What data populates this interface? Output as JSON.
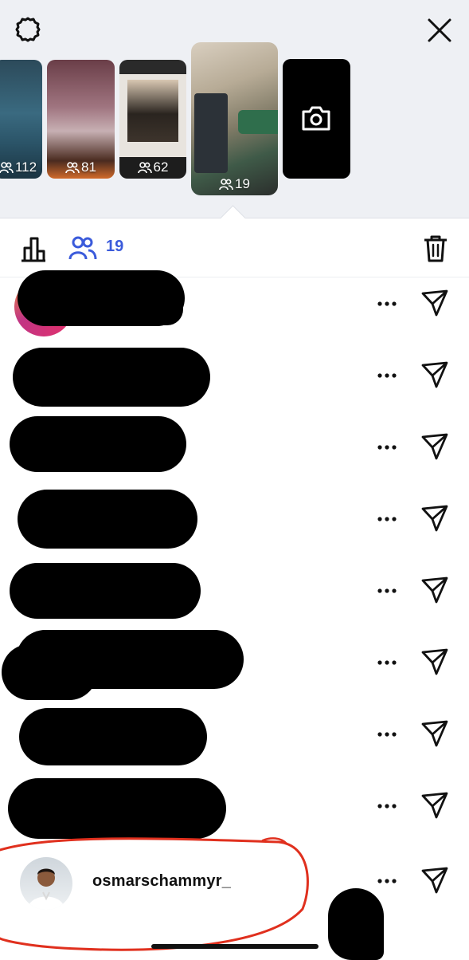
{
  "header": {
    "settings_icon": "settings-gear-icon",
    "close_icon": "close-icon"
  },
  "stories": [
    {
      "label": "112",
      "icon": "viewers-icon"
    },
    {
      "label": "81",
      "icon": "viewers-icon"
    },
    {
      "label": "62",
      "icon": "viewers-icon"
    },
    {
      "label": "19",
      "icon": "viewers-icon",
      "selected": true
    },
    {
      "label": "",
      "icon": "camera-icon"
    }
  ],
  "tabs": {
    "insights_icon": "bar-chart-icon",
    "viewers_icon": "viewers-icon",
    "viewers_count": "19",
    "delete_icon": "trash-icon",
    "accent": "#3b5bdb"
  },
  "viewers": [
    {
      "username": "",
      "redacted": true
    },
    {
      "username": "",
      "redacted": true
    },
    {
      "username": "",
      "redacted": true
    },
    {
      "username": "",
      "redacted": true
    },
    {
      "username": "",
      "redacted": true
    },
    {
      "username": "",
      "redacted": true
    },
    {
      "username": "",
      "redacted": true
    },
    {
      "username": "",
      "redacted": true
    },
    {
      "username": "osmarschammyr_",
      "redacted": false
    }
  ],
  "annotation_color": "#e0301e"
}
